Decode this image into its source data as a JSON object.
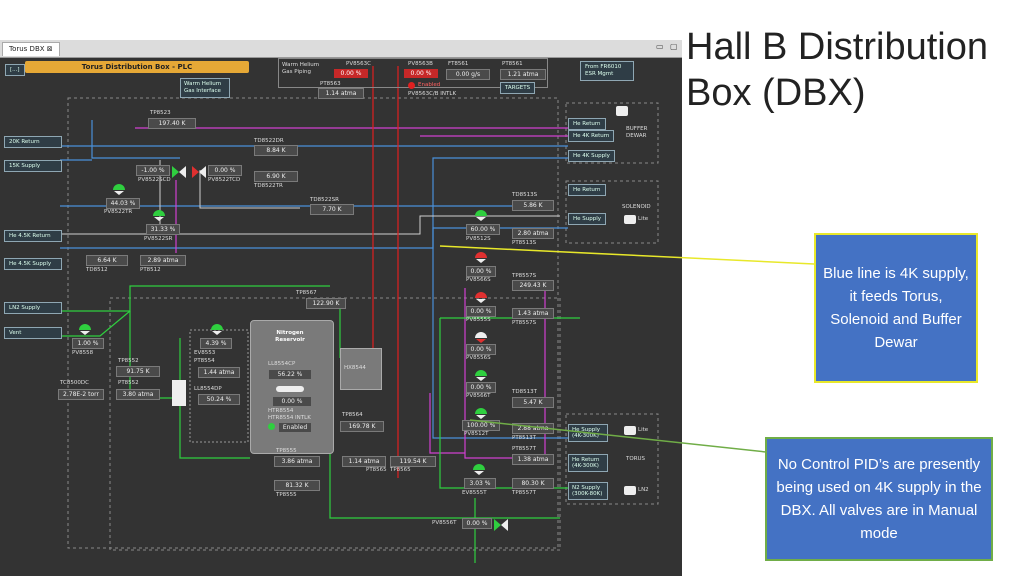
{
  "slide": {
    "title": "Hall B Distribution Box (DBX)"
  },
  "window": {
    "tab_title": "Torus DBX",
    "panel_title": "Torus Distribution Box - PLC",
    "menu_button": "[...]"
  },
  "header": {
    "warm_helium_piping": "Warm Helium Gas Piping",
    "pv8563c": "PV8563C",
    "pv8563c_val": "0.00 %",
    "pv8563b": "PV8563B",
    "pv8563b_val": "0.00 %",
    "ft8561": "FT8561",
    "ft8561_val": "0.00 g/s",
    "pt8561": "PT8561",
    "pt8561_val": "1.21 atma",
    "pt8563": "PT8563",
    "pt8563_val": "1.14 atma",
    "enabled": "Enabled",
    "intlk": "PV8563C/B INTLK",
    "targets": "TARGETS",
    "from_esr": "From FR6010 ESR Mgmt",
    "warm_helium_interface": "Warm Helium Gas Interface"
  },
  "left_ports": [
    "20K Return",
    "15K Supply",
    "He 4.5K Return",
    "He 4.5K Supply",
    "LN2 Supply",
    "Vent"
  ],
  "right_ports": {
    "buffer_group": [
      "He Return",
      "He 4K Return",
      "He 4K Supply"
    ],
    "buffer_label": "BUFFER DEWAR",
    "solenoid_group": [
      "He Return",
      "He Supply"
    ],
    "solenoid_label": "SOLENOID",
    "torus_group": [
      "He Supply (4K-300K)",
      "He Return (4K-300K)"
    ],
    "torus_label": "TORUS",
    "n2_supply": "N2 Supply (300K-80K)",
    "lite_label": "Lite",
    "ln2_label": "LN2"
  },
  "instruments": {
    "tp8523": "TP8523",
    "tp8523_val": "197.40 K",
    "td8522dr": "TD8522DR",
    "td8522dr_val": "8.84 K",
    "pv8522scd": "PV8522SCD",
    "pv8522scd_val": "-1.00 %",
    "pv8522tcd": "PV8522TCD",
    "pv8522tcd_val": "0.00 %",
    "td8522tr_val": "6.90 K",
    "td8522tr": "TD8522TR",
    "pv8522tr_val": "44.03 %",
    "pv8522tr": "PV8522TR",
    "td8522sr": "TD8522SR",
    "td8522sr_val": "7.70 K",
    "pv8522sr_val": "31.33 %",
    "pv8522sr": "PV8522SR",
    "td8512_val": "6.64 K",
    "td8512": "TD8512",
    "pt8512_val": "2.89 atma",
    "pt8512": "PT8512",
    "pv8558_val": "1.00 %",
    "pv8558": "PV8558",
    "tp8567": "TP8567",
    "tp8567_val": "122.90 K",
    "ev8553_val": "4.39 %",
    "ev8553": "EV8553",
    "pt8554": "PT8554",
    "pt8554_val": "1.44 atma",
    "tp8552": "TP8552",
    "tp8552_val": "91.75 K",
    "pt8552": "PT8552",
    "pt8552_val": "3.80 atma",
    "tc8500dc": "TC8500DC",
    "tc8500dc_val": "2.78E-2 torr",
    "ll8554dp": "LL8554DP",
    "ll8554dp_val": "50.24 %",
    "reservoir": "Nitrogen Reservoir",
    "ll8554cp": "LL8554CP",
    "ll8554cp_val": "56.22 %",
    "htr_val": "0.00 %",
    "htr8554": "HTR8554",
    "htr_intlk": "HTR8554 INTLK",
    "htr_enabled": "Enabled",
    "hx8544": "HX8544",
    "tp8564": "TP8564",
    "tp8564_val": "169.78 K",
    "tp8555": "TP8555",
    "tp8555_val": "3.86 atma",
    "t8555b_val": "81.32 K",
    "t8555b": "TP8555",
    "pt8565_val": "1.14 atma",
    "pt8565": "PT8565",
    "tp8565_val": "119.54 K",
    "tp8565": "TP8565",
    "td8513s": "TD8513S",
    "td8513s_val": "5.86 K",
    "pv8512s_val": "60.00 %",
    "pv8512s": "PV8512S",
    "pt8513s_val": "2.80 atma",
    "pt8513s": "PT8513S",
    "pv8566s_val": "0.00 %",
    "pv8566s": "PV8566S",
    "tp8557s": "TP8557S",
    "tp8557s_val": "249.43 K",
    "pv8555s_val": "0.00 %",
    "pv8555s": "PV8555S",
    "pt8557s_val": "1.43 atma",
    "pt8557s": "PT8557S",
    "pv8556s_val": "0.00 %",
    "pv8556s": "PV8556S",
    "pv8566t_val": "0.00 %",
    "pv8566t": "PV8566T",
    "td8513t": "TD8513T",
    "td8513t_val": "5.47 K",
    "pv8512t_val": "100.00 %",
    "pv8512t": "PV8512T",
    "pt8513t_val": "2.88 atma",
    "pt8513t": "PT8513T",
    "pt8557t": "PT8557T",
    "pt8557t_val": "1.38 atma",
    "ev8555t_val": "3.03 %",
    "ev8555t": "EV8555T",
    "tp8557t_val": "80.30 K",
    "tp8557t": "TP8557T",
    "pv8556t": "PV8556T",
    "pv8556t_val": "0.00 %"
  },
  "callouts": {
    "blue": "Blue line is 4K supply, it feeds Torus, Solenoid and Buffer Dewar",
    "green": "No Control PID’s are presently being used on 4K supply in the DBX.  All valves are in Manual mode"
  },
  "colors": {
    "blue_line": "#4a90d9",
    "magenta_line": "#d040d0",
    "green_line": "#2fcf3f",
    "red_line": "#e02020",
    "callout_blue": "#4472c4",
    "callout_green": "#70ad47",
    "valve_green": "#2fcf3f",
    "valve_red": "#e03030"
  }
}
